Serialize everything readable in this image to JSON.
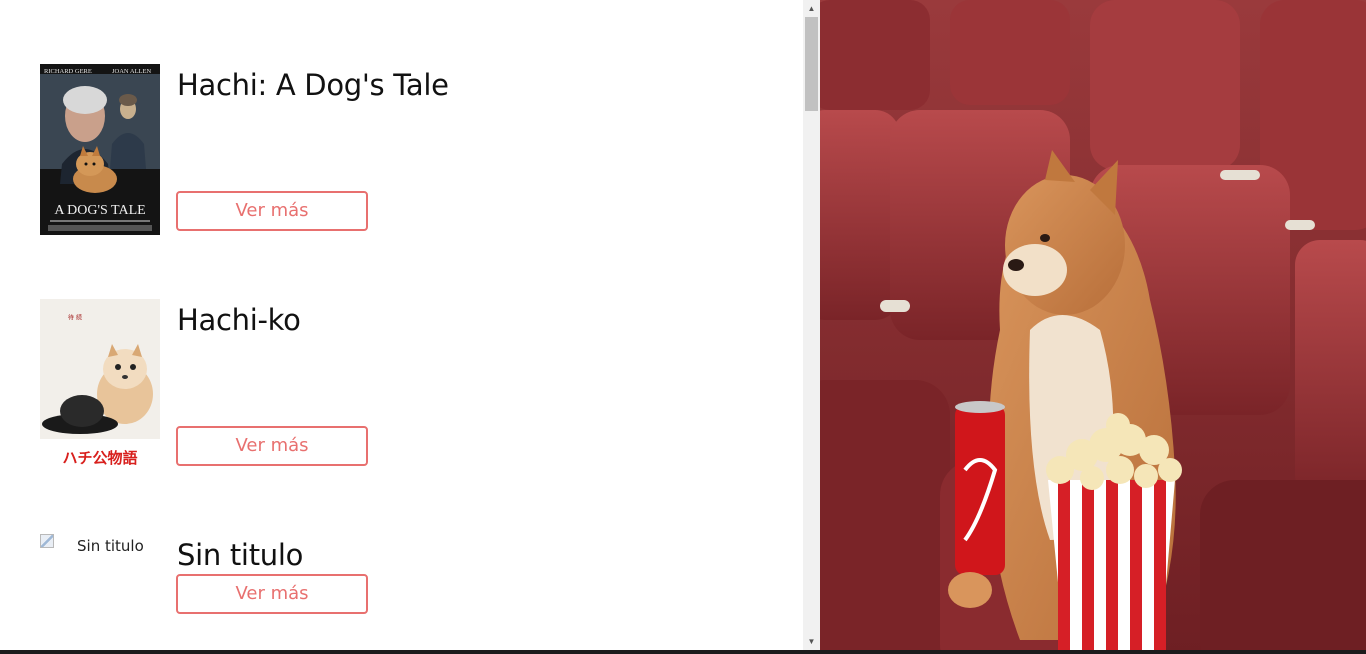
{
  "movies": [
    {
      "title": "Hachi: A Dog's Tale",
      "button_label": "Ver más",
      "poster_icon": "movie-poster-hachi-a-dogs-tale",
      "poster_credits_left": "RICHARD GERE",
      "poster_credits_right": "JOAN ALLEN",
      "poster_title": "A DOG'S TALE"
    },
    {
      "title": "Hachi-ko",
      "button_label": "Ver más",
      "poster_icon": "movie-poster-hachiko",
      "poster_title": "ハチ公物語"
    },
    {
      "title": "Sin titulo",
      "button_label": "Ver más",
      "poster_alt": "Sin titulo",
      "poster_icon": "broken-image-icon"
    }
  ],
  "hero": {
    "icon": "shiba-dog-cinema-popcorn-image"
  },
  "colors": {
    "accent": "#e8706f",
    "seat_red": "#8e2a2e",
    "text": "#111111"
  }
}
